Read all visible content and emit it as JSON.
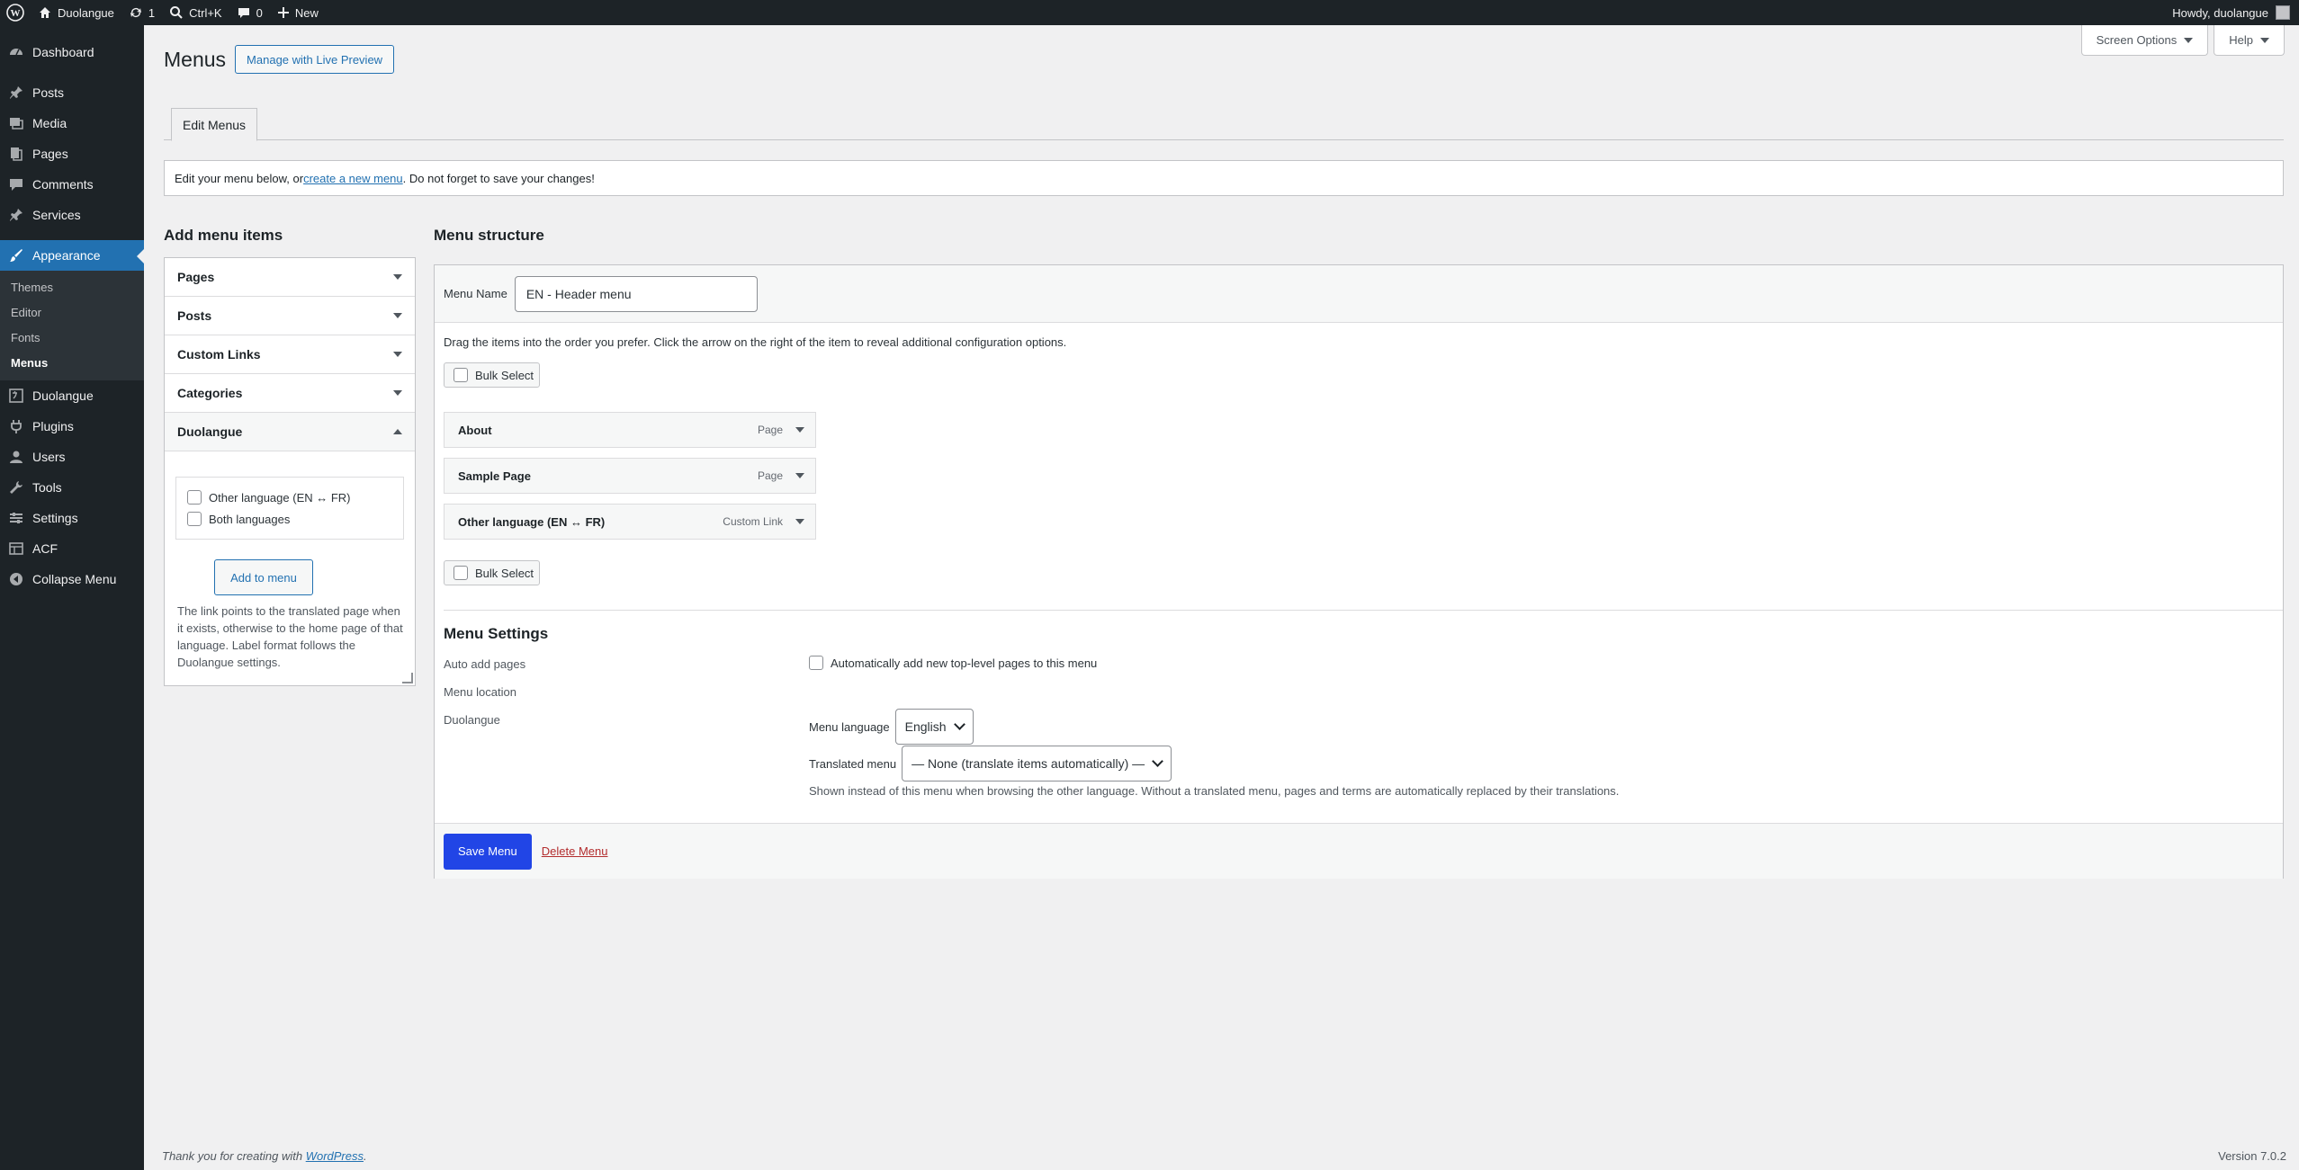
{
  "adminbar": {
    "site_name": "Duolangue",
    "updates_count": "1",
    "search_shortcut": "Ctrl+K",
    "comments_count": "0",
    "new_label": "New",
    "howdy": "Howdy, duolangue"
  },
  "sidebar": {
    "items": [
      {
        "label": "Dashboard",
        "icon": "dashboard-icon"
      },
      {
        "label": "Posts",
        "icon": "pin-icon"
      },
      {
        "label": "Media",
        "icon": "media-icon"
      },
      {
        "label": "Pages",
        "icon": "pages-icon"
      },
      {
        "label": "Comments",
        "icon": "comments-icon"
      },
      {
        "label": "Services",
        "icon": "pin-icon"
      },
      {
        "label": "Appearance",
        "icon": "brush-icon"
      },
      {
        "label": "Duolangue",
        "icon": "translate-icon"
      },
      {
        "label": "Plugins",
        "icon": "plug-icon"
      },
      {
        "label": "Users",
        "icon": "users-icon"
      },
      {
        "label": "Tools",
        "icon": "wrench-icon"
      },
      {
        "label": "Settings",
        "icon": "settings-icon"
      },
      {
        "label": "ACF",
        "icon": "grid-icon"
      },
      {
        "label": "Collapse Menu",
        "icon": "collapse-icon"
      }
    ],
    "submenu": [
      "Themes",
      "Editor",
      "Fonts",
      "Menus"
    ]
  },
  "header": {
    "title": "Menus",
    "live_preview": "Manage with Live Preview",
    "screen_options": "Screen Options",
    "help": "Help",
    "tab": "Edit Menus"
  },
  "notice": {
    "before": "Edit your menu below, or ",
    "link": "create a new menu",
    "after": ". Do not forget to save your changes!"
  },
  "add_items": {
    "title": "Add menu items",
    "sections": [
      "Pages",
      "Posts",
      "Custom Links",
      "Categories",
      "Duolangue"
    ],
    "options": [
      "Other language (EN ↔ FR)",
      "Both languages"
    ],
    "add_button": "Add to menu",
    "help": "The link points to the translated page when it exists, otherwise to the home page of that language. Label format follows the Duolangue settings."
  },
  "structure": {
    "title": "Menu structure",
    "menu_name_label": "Menu Name",
    "menu_name_value": "EN - Header menu",
    "instructions": "Drag the items into the order you prefer. Click the arrow on the right of the item to reveal additional configuration options.",
    "bulk_select": "Bulk Select",
    "items": [
      {
        "title": "About",
        "type": "Page"
      },
      {
        "title": "Sample Page",
        "type": "Page"
      },
      {
        "title": "Other language (EN ↔ FR)",
        "type": "Custom Link"
      }
    ]
  },
  "settings": {
    "title": "Menu Settings",
    "auto_add_label": "Auto add pages",
    "auto_add_option": "Automatically add new top-level pages to this menu",
    "location_label": "Menu location",
    "duolangue_label": "Duolangue",
    "menu_language_label": "Menu language",
    "menu_language_value": "English",
    "translated_menu_label": "Translated menu",
    "translated_menu_value": "— None (translate items automatically) —",
    "hint": "Shown instead of this menu when browsing the other language. Without a translated menu, pages and terms are automatically replaced by their translations."
  },
  "actions": {
    "save": "Save Menu",
    "delete": "Delete Menu"
  },
  "footer": {
    "thanks_before": "Thank you for creating with ",
    "thanks_link": "WordPress",
    "thanks_after": ".",
    "version": "Version 7.0.2"
  },
  "colors": {
    "primary": "#2145e6",
    "admin_dark": "#1d2327",
    "accent": "#2271b1"
  }
}
